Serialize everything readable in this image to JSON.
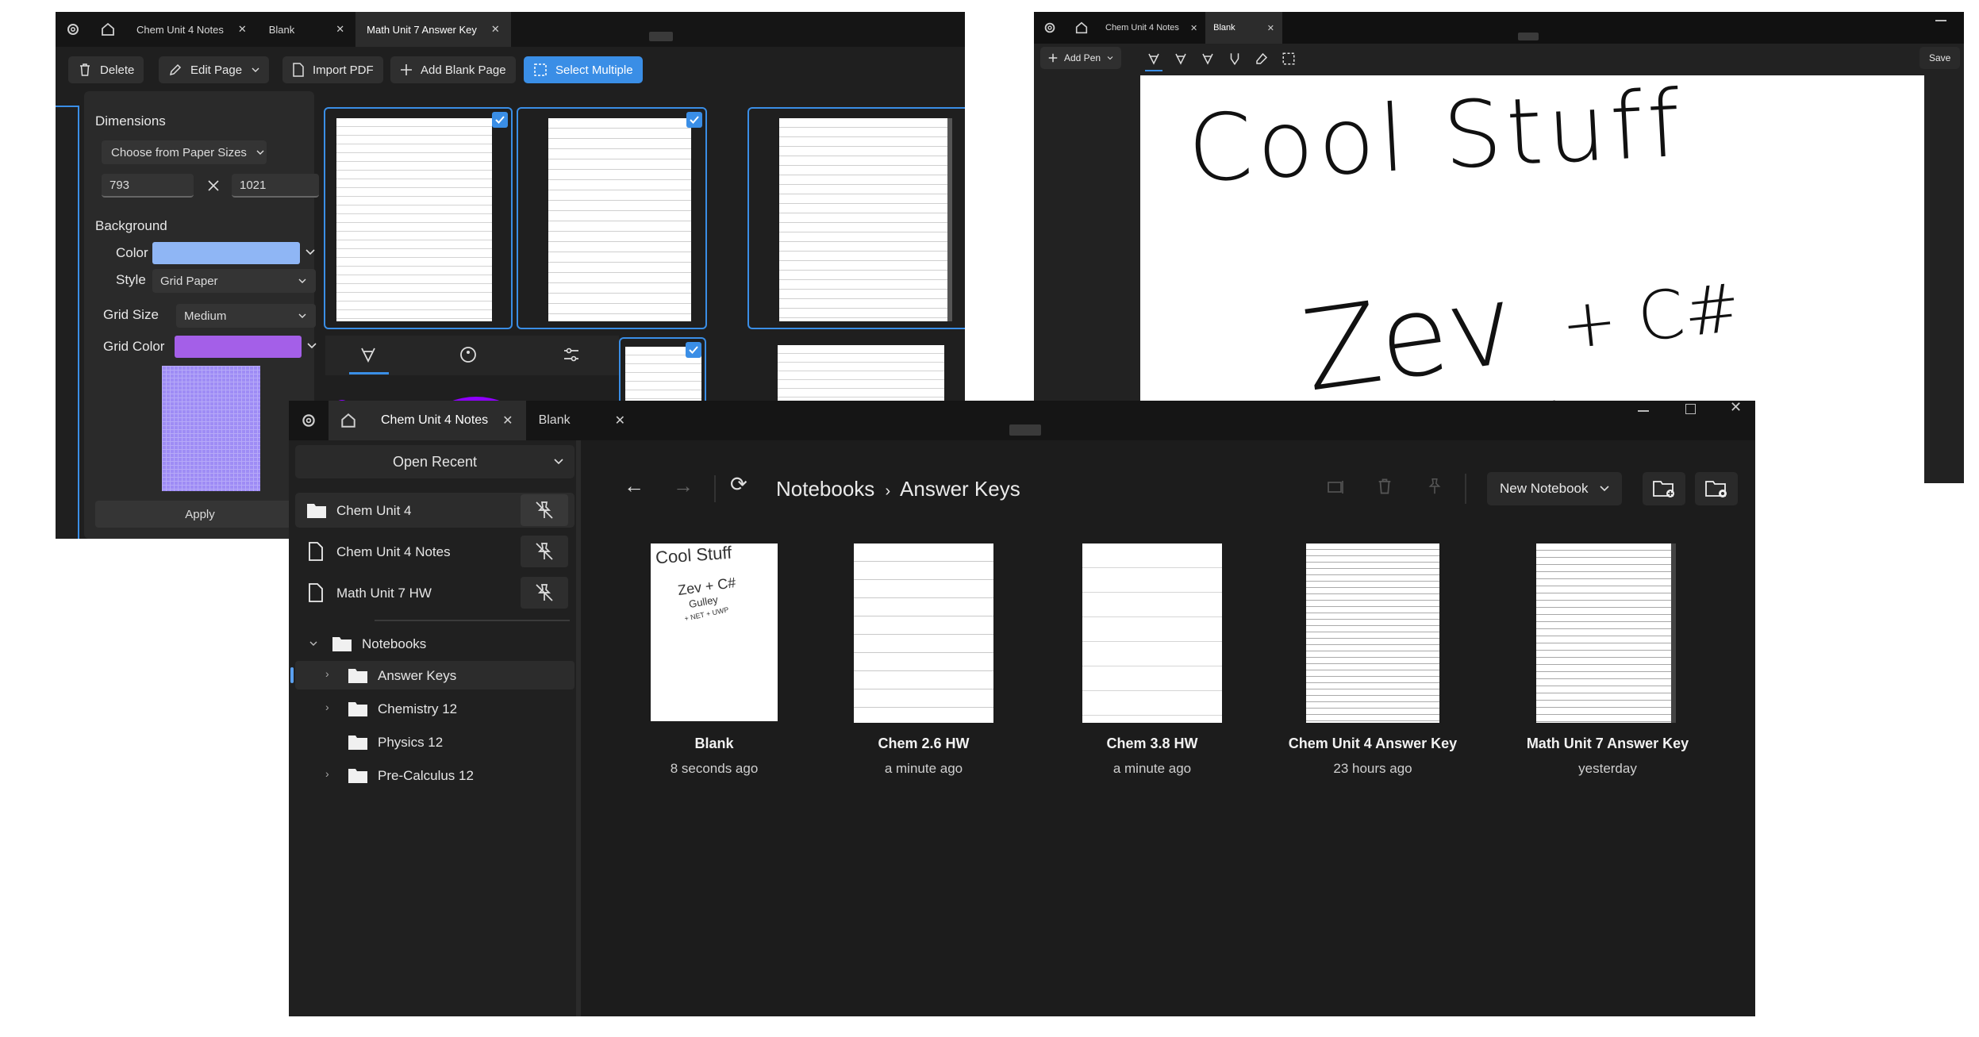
{
  "win1": {
    "tabs": [
      {
        "label": "Chem Unit 4 Notes",
        "active": false
      },
      {
        "label": "Blank",
        "active": false
      },
      {
        "label": "Math Unit 7 Answer Key",
        "active": true
      }
    ],
    "toolbar": {
      "delete": "Delete",
      "edit_page": "Edit Page",
      "import_pdf": "Import PDF",
      "add_blank_page": "Add Blank Page",
      "select_multiple": "Select Multiple"
    },
    "panel": {
      "dimensions_label": "Dimensions",
      "paper_sizes": "Choose from Paper Sizes",
      "width": "793",
      "height": "1021",
      "background_label": "Background",
      "color_label": "Color",
      "color_value": "#8fb6f5",
      "style_label": "Style",
      "style_value": "Grid Paper",
      "grid_size_label": "Grid Size",
      "grid_size_value": "Medium",
      "grid_color_label": "Grid Color",
      "grid_color_value": "#a45fe8",
      "apply": "Apply"
    }
  },
  "win2": {
    "tabs": [
      {
        "label": "Chem Unit 4 Notes",
        "active": false
      },
      {
        "label": "Blank",
        "active": true
      }
    ],
    "add_pen": "Add Pen",
    "save": "Save",
    "ink": {
      "line1": "Cool Stuff",
      "line2": "Zev",
      "line3": "+ C#",
      "line4": "Gulley"
    }
  },
  "win3": {
    "tabs": [
      {
        "label": "Chem Unit 4 Notes",
        "active": true
      },
      {
        "label": "Blank",
        "active": false
      }
    ],
    "open_recent": "Open Recent",
    "recent": [
      "Chem Unit 4",
      "Chem Unit 4 Notes",
      "Math Unit 7 HW"
    ],
    "tree": {
      "root": "Notebooks",
      "children": [
        "Answer Keys",
        "Chemistry 12",
        "Physics 12",
        "Pre-Calculus 12"
      ]
    },
    "breadcrumb": {
      "root": "Notebooks",
      "sep": "›",
      "current": "Answer Keys"
    },
    "new_notebook": "New Notebook",
    "notebooks": [
      {
        "title": "Blank",
        "time": "8 seconds ago"
      },
      {
        "title": "Chem 2.6 HW",
        "time": "a minute ago"
      },
      {
        "title": "Chem 3.8 HW",
        "time": "a minute ago"
      },
      {
        "title": "Chem Unit 4 Answer Key",
        "time": "23 hours ago"
      },
      {
        "title": "Math Unit 7 Answer Key",
        "time": "yesterday"
      }
    ],
    "thumb_ink": {
      "l1": "Cool Stuff",
      "l2": "Zev + C#",
      "l3": "Gulley",
      "l4": "+ NET + UWP"
    }
  }
}
